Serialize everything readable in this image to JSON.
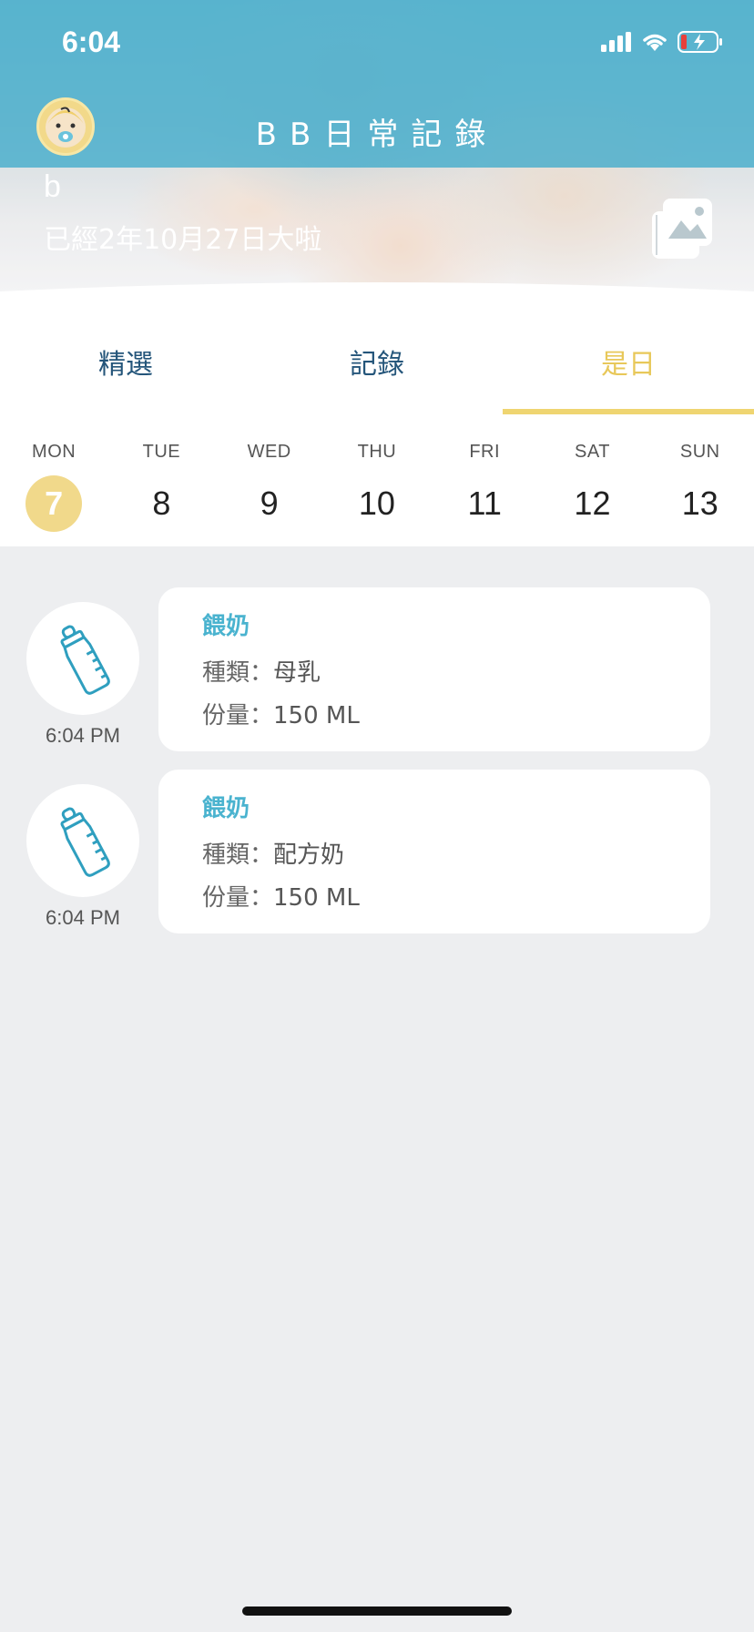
{
  "status_bar": {
    "time": "6:04"
  },
  "header": {
    "title": "BB日常記錄"
  },
  "baby": {
    "name": "b",
    "age_text": "已經2年10月27日大啦"
  },
  "tabs": [
    {
      "label": "精選",
      "active": false
    },
    {
      "label": "記錄",
      "active": false
    },
    {
      "label": "是日",
      "active": true
    }
  ],
  "week": [
    {
      "day": "MON",
      "date": "7",
      "selected": true
    },
    {
      "day": "TUE",
      "date": "8",
      "selected": false
    },
    {
      "day": "WED",
      "date": "9",
      "selected": false
    },
    {
      "day": "THU",
      "date": "10",
      "selected": false
    },
    {
      "day": "FRI",
      "date": "11",
      "selected": false
    },
    {
      "day": "SAT",
      "date": "12",
      "selected": false
    },
    {
      "day": "SUN",
      "date": "13",
      "selected": false
    }
  ],
  "records": [
    {
      "icon": "baby-bottle-icon",
      "time": "6:04 PM",
      "title": "餵奶",
      "type_label": "種類：",
      "type_value": "母乳",
      "amount_label": "份量：",
      "amount_value": "150 ML"
    },
    {
      "icon": "baby-bottle-icon",
      "time": "6:04 PM",
      "title": "餵奶",
      "type_label": "種類：",
      "type_value": "配方奶",
      "amount_label": "份量：",
      "amount_value": "150 ML"
    }
  ],
  "colors": {
    "header_tint": "#48afcd",
    "tab_text": "#24557a",
    "accent_yellow": "#efd571",
    "record_title": "#4ab3cf",
    "background": "#edeef0"
  }
}
